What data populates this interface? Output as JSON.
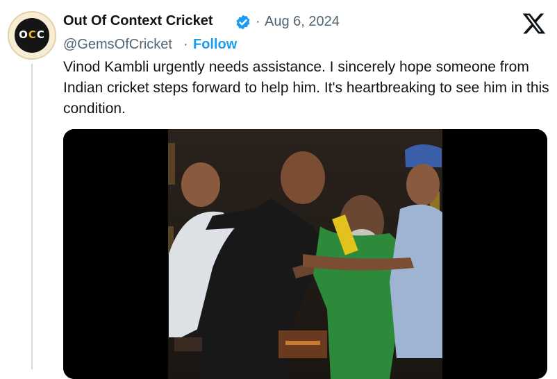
{
  "author": {
    "name": "Out Of Context Cricket",
    "handle": "@GemsOfCricket",
    "avatar_text": "OCC",
    "verified": true
  },
  "meta": {
    "separator": "·",
    "date": "Aug 6, 2024",
    "follow_label": "Follow"
  },
  "tweet": {
    "text": "Vinod Kambli urgently needs assistance. I sincerely hope someone from Indian cricket steps forward to help him. It's heartbreaking to see him in this condition."
  },
  "media": {
    "type": "video",
    "description_icon": "video-frame"
  },
  "icons": {
    "verified": "verified-badge-icon",
    "platform": "x-logo-icon"
  },
  "colors": {
    "link": "#1d9bf0",
    "secondary_text": "#536471",
    "primary_text": "#0f1419",
    "verified": "#1d9bf0"
  }
}
